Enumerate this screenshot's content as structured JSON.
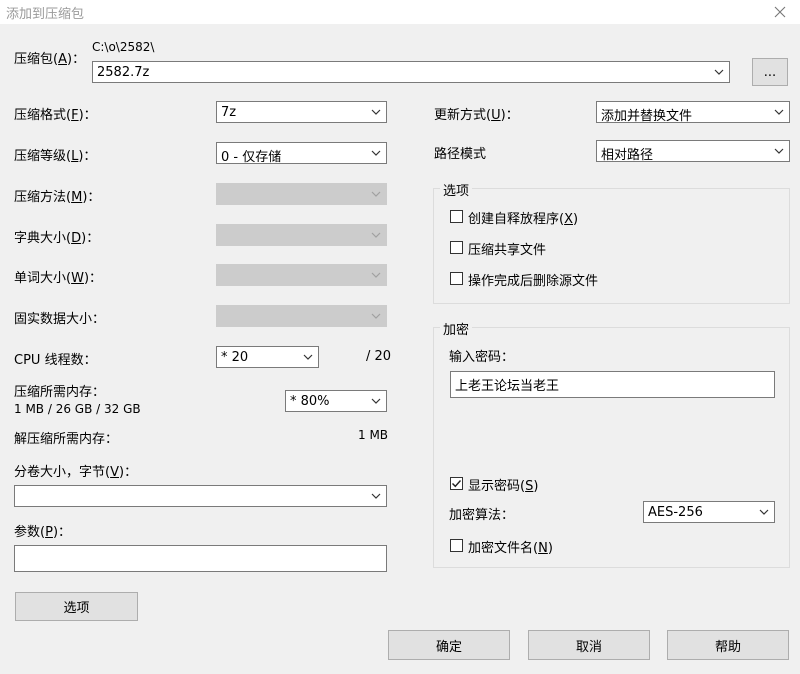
{
  "window": {
    "title": "添加到压缩包"
  },
  "archive": {
    "label": "压缩包",
    "mnemonic": "A",
    "suffix": "：",
    "path": "C:\\o\\2582\\",
    "filename": "2582.7z",
    "browse_label": "..."
  },
  "left": {
    "format": {
      "label": "压缩格式",
      "mnemonic": "F",
      "suffix": "：",
      "value": "7z"
    },
    "level": {
      "label": "压缩等级",
      "mnemonic": "L",
      "suffix": "：",
      "value": "0 - 仅存储"
    },
    "method": {
      "label": "压缩方法",
      "mnemonic": "M",
      "suffix": "：",
      "value": ""
    },
    "dict": {
      "label": "字典大小",
      "mnemonic": "D",
      "suffix": "：",
      "value": ""
    },
    "word": {
      "label": "单词大小",
      "mnemonic": "W",
      "suffix": "：",
      "value": ""
    },
    "solid": {
      "label": "固实数据大小：",
      "value": ""
    },
    "cpu": {
      "label": "CPU 线程数：",
      "value": "* 20",
      "total": "/ 20"
    },
    "mem_compress": {
      "label": "压缩所需内存：",
      "detail": "1 MB / 26 GB / 32 GB",
      "value": "* 80%"
    },
    "mem_decompress": {
      "label": "解压缩所需内存：",
      "value": "1 MB"
    },
    "volume": {
      "label": "分卷大小，字节",
      "mnemonic": "V",
      "suffix": "：",
      "value": ""
    },
    "params": {
      "label": "参数",
      "mnemonic": "P",
      "suffix": "：",
      "value": ""
    },
    "options_button": "选项"
  },
  "right": {
    "update": {
      "label": "更新方式",
      "mnemonic": "U",
      "suffix": "：",
      "value": "添加并替换文件"
    },
    "pathmode": {
      "label": "路径模式",
      "value": "相对路径"
    },
    "options_group": {
      "title": "选项",
      "sfx": {
        "label": "创建自释放程序",
        "mnemonic": "X",
        "checked": false
      },
      "shared": {
        "label": "压缩共享文件",
        "checked": false
      },
      "delete": {
        "label": "操作完成后删除源文件",
        "checked": false
      }
    },
    "encryption": {
      "title": "加密",
      "password_label": "输入密码：",
      "password_value": "上老王论坛当老王",
      "show_password": {
        "label": "显示密码",
        "mnemonic": "S",
        "checked": true
      },
      "method_label": "加密算法：",
      "method_value": "AES-256",
      "encrypt_names": {
        "label": "加密文件名",
        "mnemonic": "N",
        "checked": false
      }
    }
  },
  "buttons": {
    "ok": "确定",
    "cancel": "取消",
    "help": "帮助"
  }
}
